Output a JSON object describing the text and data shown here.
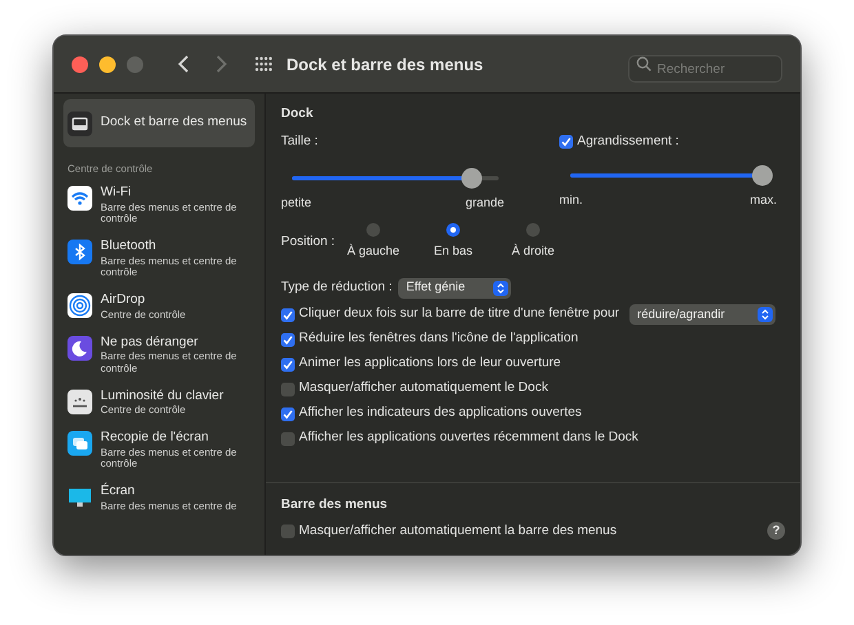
{
  "window": {
    "title": "Dock et barre des menus"
  },
  "search": {
    "placeholder": "Rechercher"
  },
  "sidebar": {
    "top_item": {
      "kind": "dock",
      "title": "Dock et barre des menus",
      "selected": true
    },
    "section_title": "Centre de contrôle",
    "items": [
      {
        "kind": "wifi",
        "title": "Wi-Fi",
        "subtitle": "Barre des menus et centre de contrôle",
        "selected": false
      },
      {
        "kind": "bluetooth",
        "title": "Bluetooth",
        "subtitle": "Barre des menus et centre de contrôle",
        "selected": false
      },
      {
        "kind": "airdrop",
        "title": "AirDrop",
        "subtitle": "Centre de contrôle",
        "selected": false
      },
      {
        "kind": "focus",
        "title": "Ne pas déranger",
        "subtitle": "Barre des menus et centre de contrôle",
        "selected": false
      },
      {
        "kind": "keyboard",
        "title": "Luminosité du clavier",
        "subtitle": "Centre de contrôle",
        "selected": false
      },
      {
        "kind": "mirroring",
        "title": "Recopie de l'écran",
        "subtitle": "Barre des menus et centre de contrôle",
        "selected": false
      },
      {
        "kind": "display",
        "title": "Écran",
        "subtitle": "Barre des menus et centre de",
        "selected": false
      }
    ]
  },
  "dock": {
    "title": "Dock",
    "size": {
      "label": "Taille :",
      "level": 0.87,
      "min_label": "petite",
      "max_label": "grande"
    },
    "magnification": {
      "label": "Agrandissement :",
      "checked": true,
      "level": 1,
      "min_label": "min.",
      "max_label": "max."
    },
    "position": {
      "label": "Position :",
      "options": [
        {
          "label": "À gauche",
          "selected": false
        },
        {
          "label": "En bas",
          "selected": true
        },
        {
          "label": "À droite",
          "selected": false
        }
      ]
    },
    "minimize_effect": {
      "label": "Type de réduction :",
      "value": "Effet génie"
    },
    "options": [
      {
        "label": "Cliquer deux fois sur la barre de titre d'une fenêtre pour",
        "checked": true,
        "popup_value": "réduire/agrandir"
      },
      {
        "label": "Réduire les fenêtres dans l'icône de l'application",
        "checked": true
      },
      {
        "label": "Animer les applications lors de leur ouverture",
        "checked": true
      },
      {
        "label": "Masquer/afficher automatiquement le Dock",
        "checked": false
      },
      {
        "label": "Afficher les indicateurs des applications ouvertes",
        "checked": true
      },
      {
        "label": "Afficher les applications ouvertes récemment dans le Dock",
        "checked": false
      }
    ]
  },
  "menu_bar": {
    "title": "Barre des menus",
    "options": [
      {
        "label": "Masquer/afficher automatiquement la barre des menus",
        "checked": false
      }
    ]
  },
  "help_button": "?"
}
